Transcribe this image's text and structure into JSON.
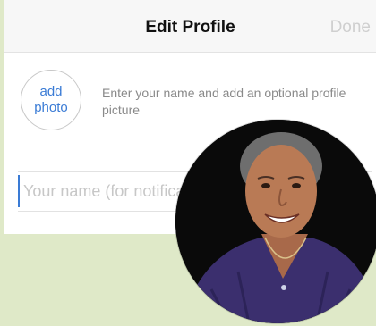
{
  "navbar": {
    "title": "Edit Profile",
    "done_label": "Done"
  },
  "profile": {
    "add_photo_line1": "add",
    "add_photo_line2": "photo",
    "hint": "Enter your name and add an optional profile picture"
  },
  "name_field": {
    "placeholder": "Your name (for notifications)",
    "value": ""
  },
  "colors": {
    "background": "#dfe9c8",
    "accent": "#3a7bd5",
    "done_disabled": "#cfcfcf",
    "sweater": "#3b2f6e"
  },
  "icons": {
    "avatar": "person-photo"
  }
}
